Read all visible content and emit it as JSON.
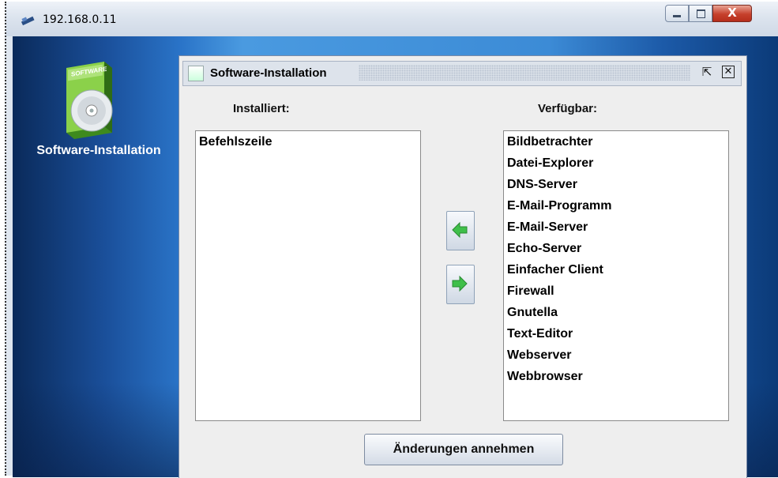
{
  "window": {
    "title": "192.168.0.11",
    "close_glyph": "X"
  },
  "desktop": {
    "icon_label": "Software-Installation",
    "icon_box_text": "SOFTWARE"
  },
  "dialog": {
    "title": "Software-Installation",
    "installed_heading": "Installiert:",
    "available_heading": "Verfügbar:",
    "installed_items": [
      "Befehlszeile"
    ],
    "available_items": [
      "Bildbetrachter",
      "Datei-Explorer",
      "DNS-Server",
      "E-Mail-Programm",
      "E-Mail-Server",
      "Echo-Server",
      "Einfacher Client",
      "Firewall",
      "Gnutella",
      "Text-Editor",
      "Webserver",
      "Webbrowser"
    ],
    "accept_button": "Änderungen annehmen"
  },
  "icons": {
    "window_app": "network-computer-icon",
    "dialog_app": "software-installation-icon",
    "move_left": "arrow-left-icon",
    "move_right": "arrow-right-icon",
    "detach": "detach-icon",
    "close": "close-icon"
  },
  "colors": {
    "arrow_green": "#3fbf4a",
    "desktop_blue": "#2a74c8"
  }
}
